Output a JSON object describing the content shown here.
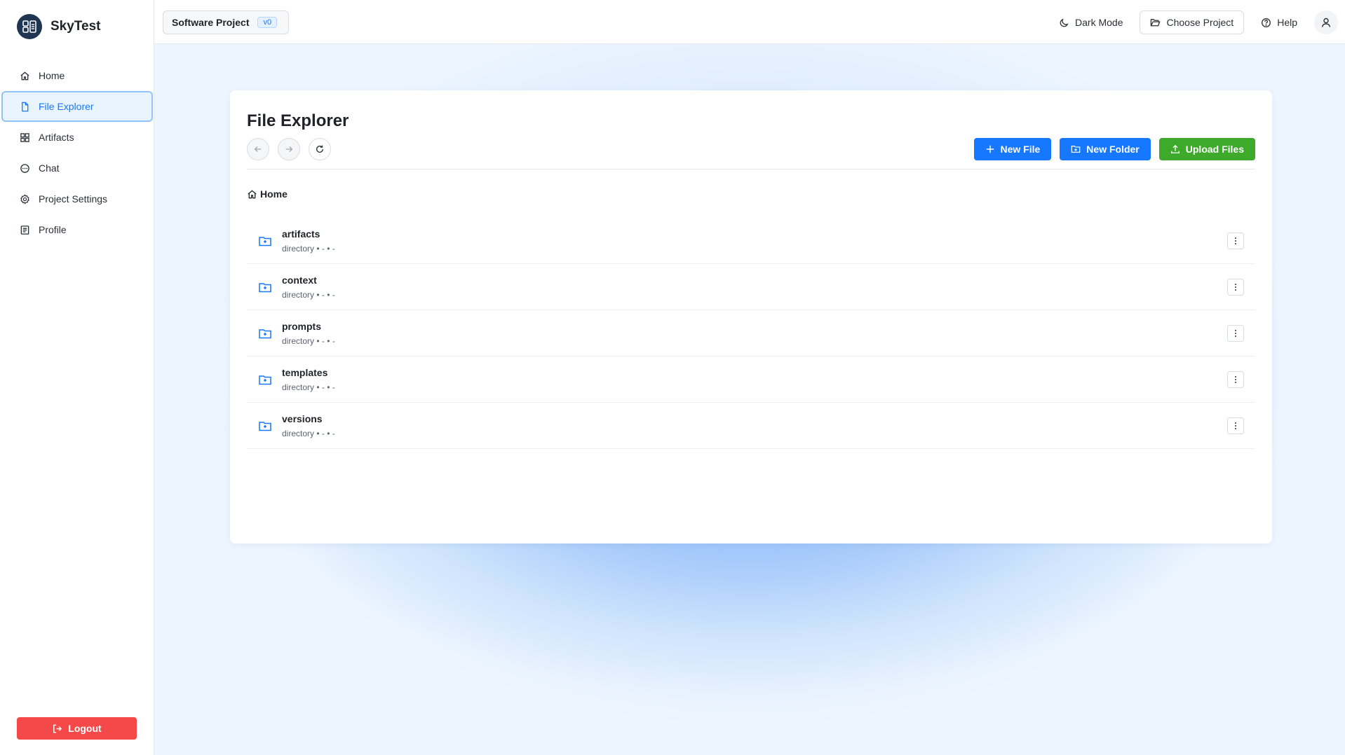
{
  "brand": {
    "name": "SkyTest"
  },
  "sidebar": {
    "items": [
      {
        "label": "Home",
        "icon": "home-icon"
      },
      {
        "label": "File Explorer",
        "icon": "file-icon",
        "active": true
      },
      {
        "label": "Artifacts",
        "icon": "grid-icon"
      },
      {
        "label": "Chat",
        "icon": "chat-icon"
      },
      {
        "label": "Project Settings",
        "icon": "gear-icon"
      },
      {
        "label": "Profile",
        "icon": "profile-icon"
      }
    ],
    "logout_label": "Logout"
  },
  "topbar": {
    "project_name": "Software Project",
    "version": "v0",
    "dark_mode_label": "Dark Mode",
    "choose_project_label": "Choose Project",
    "help_label": "Help"
  },
  "explorer": {
    "title": "File Explorer",
    "new_file_label": "New File",
    "new_folder_label": "New Folder",
    "upload_label": "Upload Files",
    "breadcrumb": "Home",
    "files": [
      {
        "name": "artifacts",
        "meta": "directory • - • -"
      },
      {
        "name": "context",
        "meta": "directory • - • -"
      },
      {
        "name": "prompts",
        "meta": "directory • - • -"
      },
      {
        "name": "templates",
        "meta": "directory • - • -"
      },
      {
        "name": "versions",
        "meta": "directory • - • -"
      }
    ]
  },
  "colors": {
    "primary": "#1677ff",
    "success": "#3daa2c",
    "danger": "#f44849",
    "active_bg": "#eaf4ff"
  }
}
